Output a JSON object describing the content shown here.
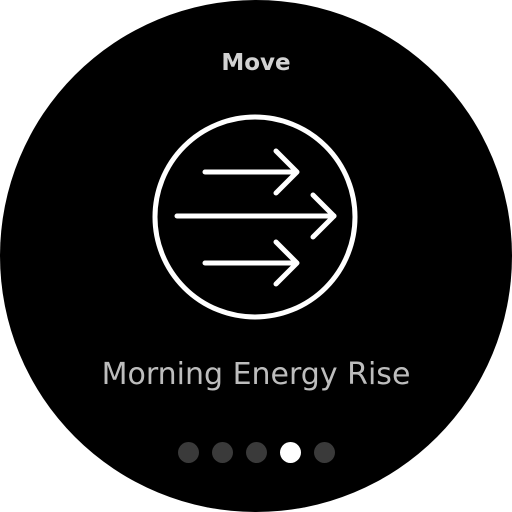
{
  "header": {
    "title": "Move"
  },
  "card": {
    "icon": "forward-arrows-icon",
    "title": "Morning Energy Rise"
  },
  "pager": {
    "count": 5,
    "active_index": 3
  },
  "colors": {
    "background": "#000000",
    "header_text": "#d2d2d2",
    "body_text": "#bdbdbd",
    "dot_inactive": "#3a3a3a",
    "dot_active": "#ffffff"
  }
}
